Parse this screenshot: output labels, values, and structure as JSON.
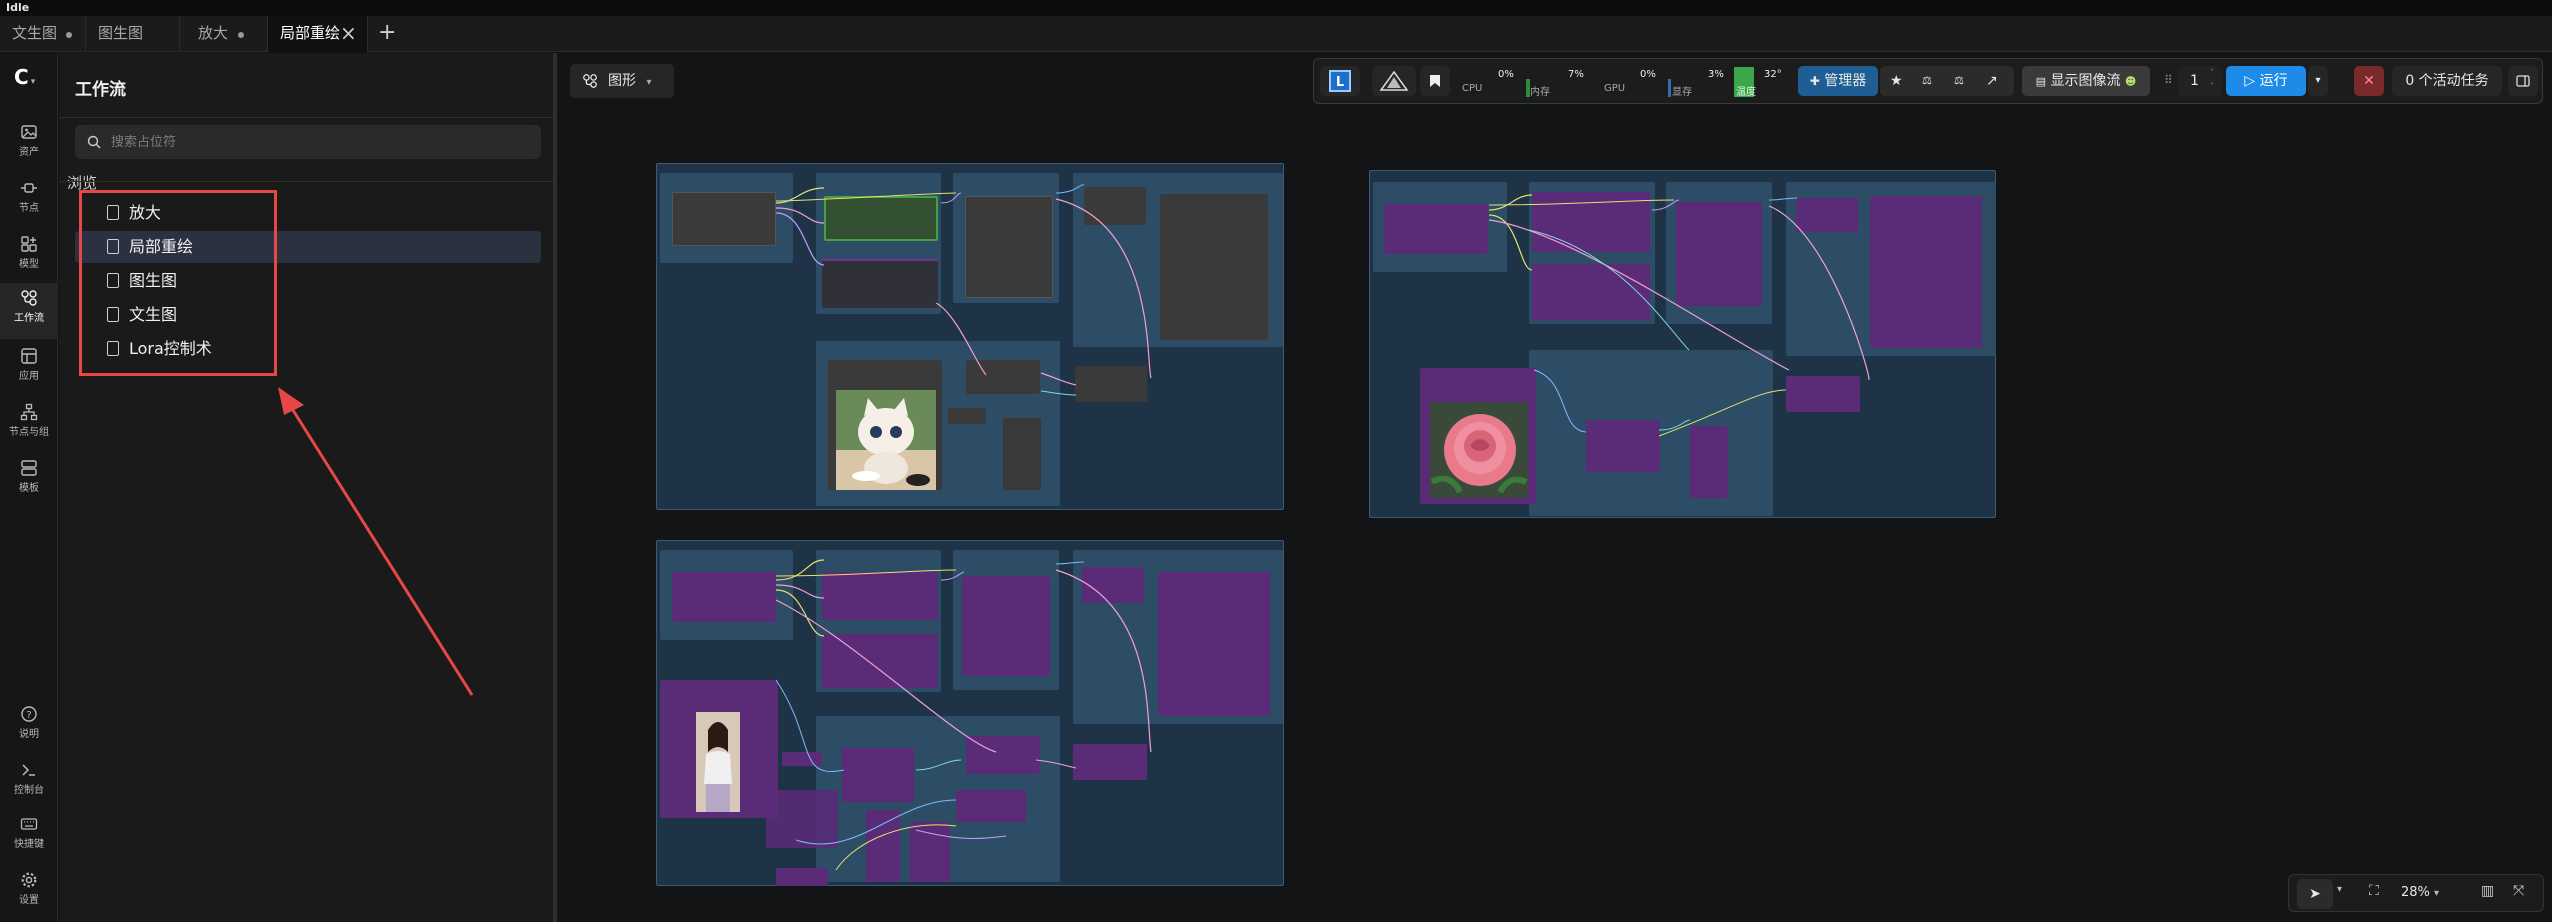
{
  "window": {
    "title": "Idle"
  },
  "tabs": [
    {
      "label": "文生图",
      "modified": true
    },
    {
      "label": "图生图",
      "modified": false
    },
    {
      "label": "放大",
      "modified": true
    },
    {
      "label": "局部重绘",
      "active": true
    }
  ],
  "rail": {
    "logo": "C",
    "items": [
      {
        "label": "资产",
        "icon": "image-icon"
      },
      {
        "label": "节点",
        "icon": "node-icon"
      },
      {
        "label": "模型",
        "icon": "model-icon"
      },
      {
        "label": "工作流",
        "icon": "workflow-icon",
        "active": true
      },
      {
        "label": "应用",
        "icon": "app-icon"
      },
      {
        "label": "节点与组",
        "icon": "tree-icon"
      },
      {
        "label": "模板",
        "icon": "template-icon"
      }
    ],
    "bottom": [
      {
        "label": "说明",
        "icon": "help-icon"
      },
      {
        "label": "控制台",
        "icon": "terminal-icon"
      },
      {
        "label": "快捷键",
        "icon": "keyboard-icon"
      },
      {
        "label": "设置",
        "icon": "gear-icon"
      }
    ]
  },
  "panel": {
    "title": "工作流",
    "search_placeholder": "搜索占位符",
    "browse_label": "浏览",
    "items": [
      "放大",
      "局部重绘",
      "图生图",
      "文生图",
      "Lora控制术"
    ]
  },
  "canvas_toolbar": {
    "view_label": "图形",
    "cpu_label": "CPU",
    "cpu_value": "0%",
    "ram_label": "内存",
    "ram_value": "7%",
    "gpu_label": "GPU",
    "gpu_value": "0%",
    "vram_label": "显存",
    "vram_value": "3%",
    "temp_label": "温度",
    "temp_value": "32°",
    "manager_label": "管理器",
    "show_image_flow_label": "显示图像流",
    "queue_count": "1",
    "run_label": "运行",
    "active_tasks_label": "0 个活动任务"
  },
  "zoom": {
    "level": "28%"
  },
  "colors": {
    "accent": "#1e8be8",
    "highlight": "#e84747",
    "group": "#2f4a62",
    "node_purple": "#5f2f7a"
  }
}
